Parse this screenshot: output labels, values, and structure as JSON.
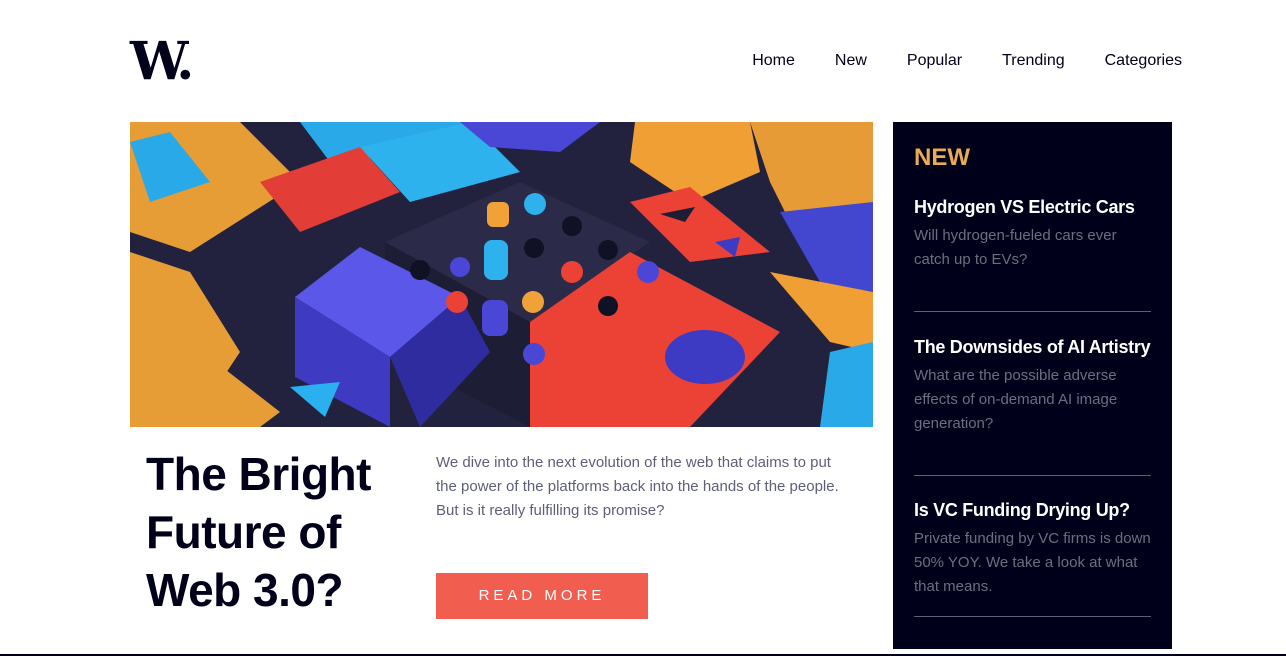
{
  "logo": {
    "text": "W."
  },
  "nav": {
    "items": [
      "Home",
      "New",
      "Popular",
      "Trending",
      "Categories"
    ]
  },
  "hero": {
    "image": "colorful-3d-blocks-illustration"
  },
  "article": {
    "title": "The Bright Future of Web 3.0?",
    "description": "We dive into the next evolution of the web that claims to put the power of the platforms back into the hands of the people. But is it really fulfilling its promise?",
    "button_label": "READ MORE"
  },
  "sidebar": {
    "heading": "NEW",
    "items": [
      {
        "title": "Hydrogen VS Electric Cars",
        "text": "Will hydrogen-fueled cars ever catch up to EVs?"
      },
      {
        "title": "The Downsides of AI Artistry",
        "text": "What are the possible adverse effects of on-demand AI image generation?"
      },
      {
        "title": "Is VC Funding Drying Up?",
        "text": "Private funding by VC firms is down 50% YOY. We take a look at what that means."
      }
    ]
  },
  "colors": {
    "accent": "#f15e50",
    "sidebar_bg": "#00001a",
    "sidebar_heading": "#e9ab53",
    "text_dark": "#00001a",
    "text_muted": "#5d5f79"
  }
}
